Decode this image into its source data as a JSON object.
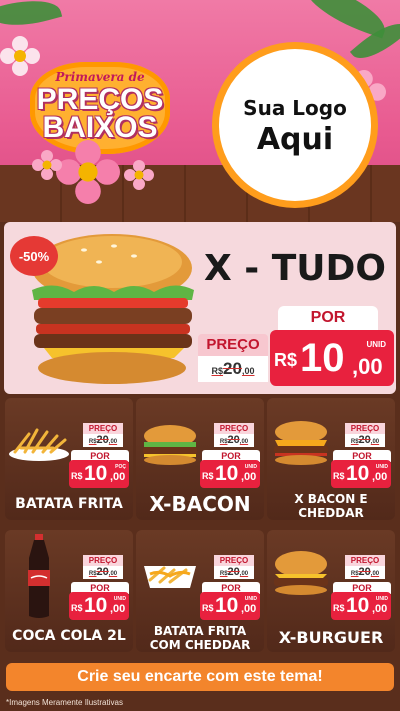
{
  "header": {
    "promo_subtitle": "Primavera de",
    "promo_title_line1": "PREÇOS",
    "promo_title_line2": "BAIXOS",
    "logo_line1": "Sua Logo",
    "logo_line2": "Aqui"
  },
  "featured": {
    "discount_badge": "-50%",
    "name": "X - TUDO",
    "preco_label": "PREÇO",
    "old_prefix": "R$",
    "old_price": "20",
    "old_cents": ",00",
    "por_label": "POR",
    "currency": "R$",
    "price_int": "10",
    "price_dec": ",00",
    "unit": "UNID"
  },
  "products": [
    {
      "name": "BATATA FRITA",
      "preco_label": "PREÇO",
      "old_prefix": "R$",
      "old_price": "20",
      "old_cents": ",00",
      "por_label": "POR",
      "currency": "R$",
      "price_int": "10",
      "price_dec": ",00",
      "unit": "POÇ"
    },
    {
      "name": "X-BACON",
      "preco_label": "PREÇO",
      "old_prefix": "R$",
      "old_price": "20",
      "old_cents": ",00",
      "por_label": "POR",
      "currency": "R$",
      "price_int": "10",
      "price_dec": ",00",
      "unit": "UNID"
    },
    {
      "name_line1": "X BACON E",
      "name_line2": "CHEDDAR",
      "preco_label": "PREÇO",
      "old_prefix": "R$",
      "old_price": "20",
      "old_cents": ",00",
      "por_label": "POR",
      "currency": "R$",
      "price_int": "10",
      "price_dec": ",00",
      "unit": "UNID"
    },
    {
      "name": "COCA COLA 2L",
      "preco_label": "PREÇO",
      "old_prefix": "R$",
      "old_price": "20",
      "old_cents": ",00",
      "por_label": "POR",
      "currency": "R$",
      "price_int": "10",
      "price_dec": ",00",
      "unit": "UNID"
    },
    {
      "name_line1": "BATATA FRITA",
      "name_line2": "COM CHEDDAR",
      "preco_label": "PREÇO",
      "old_prefix": "R$",
      "old_price": "20",
      "old_cents": ",00",
      "por_label": "POR",
      "currency": "R$",
      "price_int": "10",
      "price_dec": ",00",
      "unit": "UNID"
    },
    {
      "name": "X-BURGUER",
      "preco_label": "PREÇO",
      "old_prefix": "R$",
      "old_price": "20",
      "old_cents": ",00",
      "por_label": "POR",
      "currency": "R$",
      "price_int": "10",
      "price_dec": ",00",
      "unit": "UNID"
    }
  ],
  "footer": {
    "cta": "Crie seu encarte com este tema!",
    "disclaimer": "*Imagens Meramente Ilustrativas"
  },
  "colors": {
    "pink_header": "#e85a90",
    "price_red": "#e8213e",
    "wood_brown": "#5a2e1c",
    "cta_orange": "#f3852c",
    "logo_ring": "#ff9d1c"
  }
}
